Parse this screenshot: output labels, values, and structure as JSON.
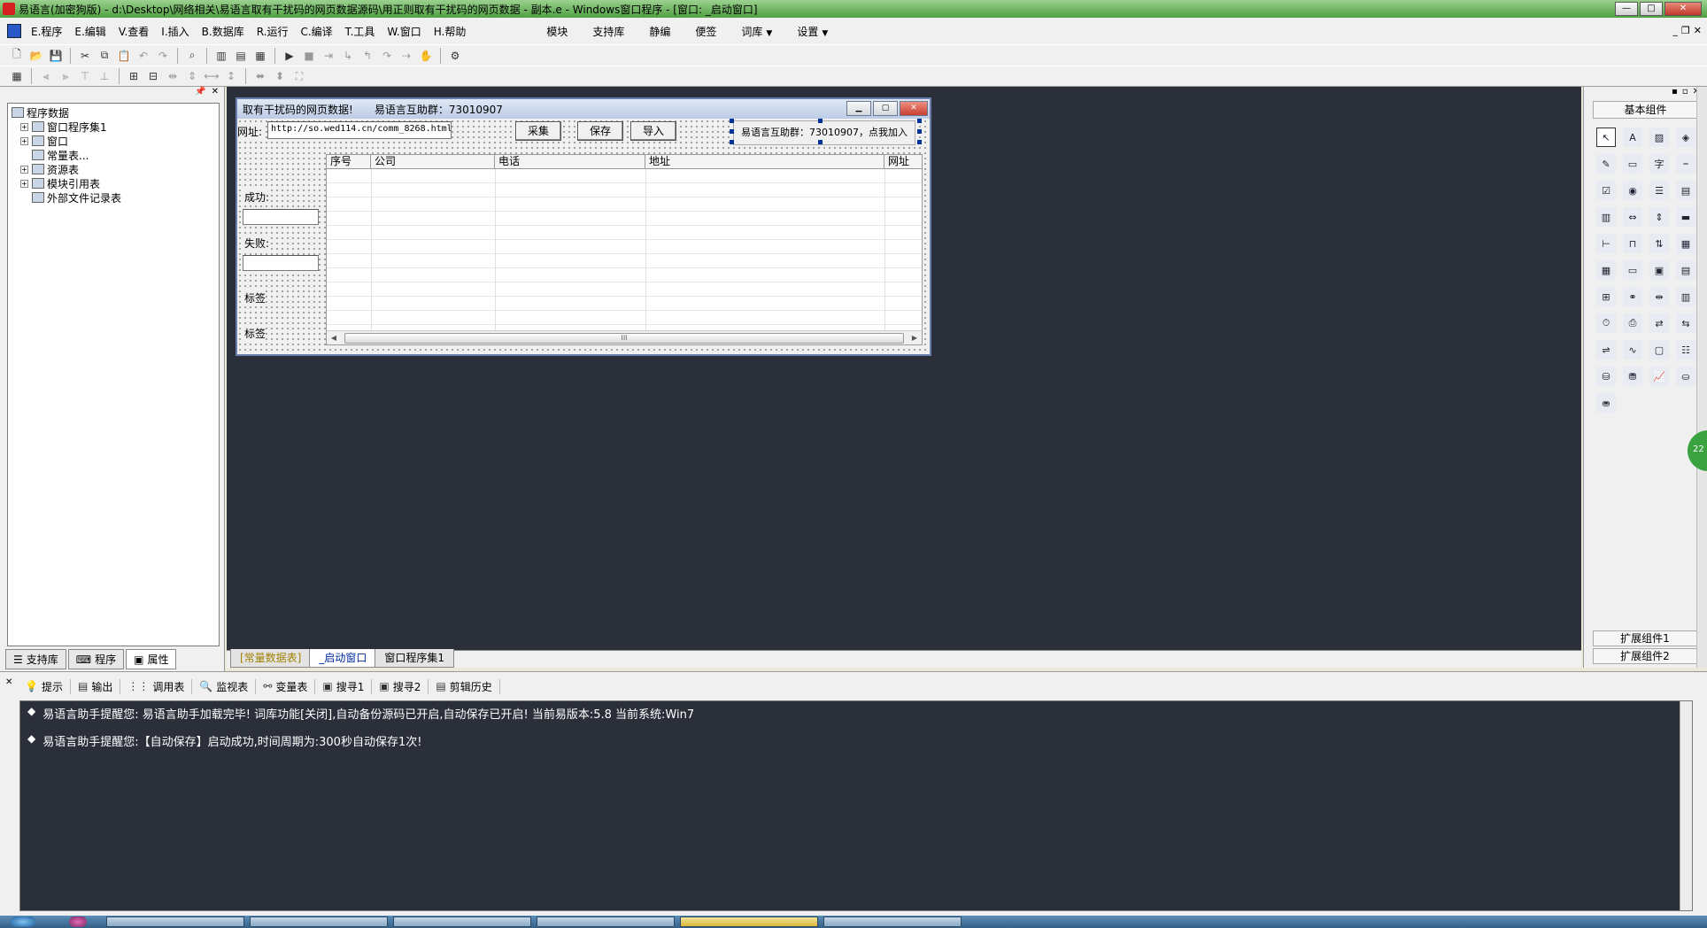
{
  "window": {
    "title": "易语言(加密狗版) - d:\\Desktop\\网络相关\\易语言取有干扰码的网页数据源码\\用正则取有干扰码的网页数据 - 副本.e - Windows窗口程序 - [窗口: _启动窗口]",
    "btn_min": "—",
    "btn_max": "□",
    "btn_close": "✕"
  },
  "menubar": {
    "items": [
      "E.程序",
      "E.编辑",
      "V.查看",
      "I.插入",
      "B.数据库",
      "R.运行",
      "C.编译",
      "T.工具",
      "W.窗口",
      "H.帮助"
    ],
    "extras": [
      "模块",
      "支持库",
      "静编",
      "便签",
      "词库",
      "设置"
    ],
    "mdi_min": "_",
    "mdi_restore": "❐",
    "mdi_close": "✕"
  },
  "left_panel": {
    "pin": "📌",
    "close": "✕",
    "root": "程序数据",
    "nodes": [
      {
        "label": "窗口程序集1",
        "expand": "+"
      },
      {
        "label": "窗口",
        "expand": "+"
      },
      {
        "label": "常量表...",
        "expand": ""
      },
      {
        "label": "资源表",
        "expand": "+"
      },
      {
        "label": "模块引用表",
        "expand": "+"
      },
      {
        "label": "外部文件记录表",
        "expand": ""
      }
    ],
    "tabs": [
      "支持库",
      "程序",
      "属性"
    ]
  },
  "form": {
    "title": "取有干扰码的网页数据!",
    "group_text": "易语言互助群：73010907",
    "url_label": "网址:",
    "url_value": "http://so.wed114.cn/comm_8268.html",
    "btn_collect": "采集",
    "btn_save": "保存",
    "btn_import": "导入",
    "hint": "易语言互助群：73010907，点我加入",
    "success_label": "成功:",
    "fail_label": "失败:",
    "label1": "标签",
    "label2": "标签",
    "columns": [
      "序号",
      "公司",
      "电话",
      "地址",
      "网址"
    ],
    "scroll_grip": "III"
  },
  "doc_tabs": [
    "[常量数据表]",
    "_启动窗口",
    "窗口程序集1"
  ],
  "right_panel": {
    "title": "基本组件",
    "ext1": "扩展组件1",
    "ext2": "扩展组件2",
    "bubble": "22"
  },
  "bottom_panel": {
    "close": "✕",
    "tabs": [
      {
        "icon": "💡",
        "label": "提示"
      },
      {
        "icon": "▤",
        "label": "输出"
      },
      {
        "icon": "⋮⋮",
        "label": "调用表"
      },
      {
        "icon": "🔍",
        "label": "监视表"
      },
      {
        "icon": "⚯",
        "label": "变量表"
      },
      {
        "icon": "▣",
        "label": "搜寻1"
      },
      {
        "icon": "▣",
        "label": "搜寻2"
      },
      {
        "icon": "▤",
        "label": "剪辑历史"
      }
    ],
    "bullet": "◆",
    "lines": [
      "易语言助手提醒您:  易语言助手加载完毕!  词库功能[关闭],自动备份源码已开启,自动保存已开启!  当前易版本:5.8  当前系统:Win7",
      "易语言助手提醒您:【自动保存】启动成功,时间周期为:300秒自动保存1次!"
    ]
  }
}
